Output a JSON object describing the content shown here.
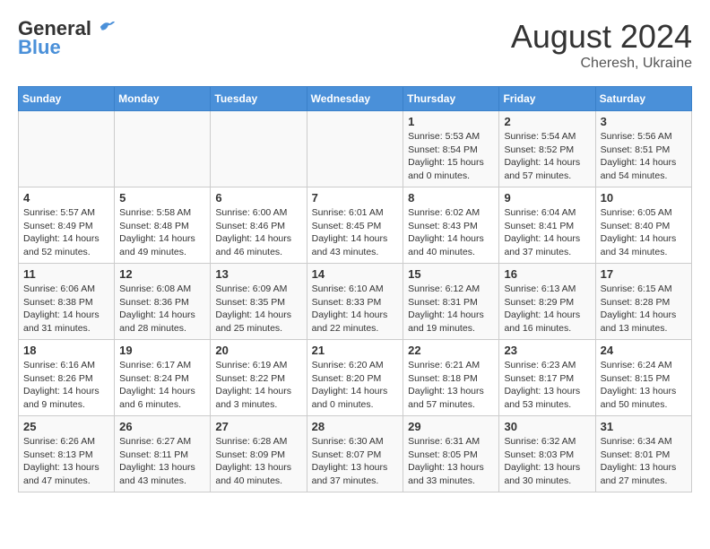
{
  "logo": {
    "line1": "General",
    "line2": "Blue"
  },
  "title": "August 2024",
  "subtitle": "Cheresh, Ukraine",
  "days_header": [
    "Sunday",
    "Monday",
    "Tuesday",
    "Wednesday",
    "Thursday",
    "Friday",
    "Saturday"
  ],
  "weeks": [
    [
      {
        "day": "",
        "info": ""
      },
      {
        "day": "",
        "info": ""
      },
      {
        "day": "",
        "info": ""
      },
      {
        "day": "",
        "info": ""
      },
      {
        "day": "1",
        "info": "Sunrise: 5:53 AM\nSunset: 8:54 PM\nDaylight: 15 hours and 0 minutes."
      },
      {
        "day": "2",
        "info": "Sunrise: 5:54 AM\nSunset: 8:52 PM\nDaylight: 14 hours and 57 minutes."
      },
      {
        "day": "3",
        "info": "Sunrise: 5:56 AM\nSunset: 8:51 PM\nDaylight: 14 hours and 54 minutes."
      }
    ],
    [
      {
        "day": "4",
        "info": "Sunrise: 5:57 AM\nSunset: 8:49 PM\nDaylight: 14 hours and 52 minutes."
      },
      {
        "day": "5",
        "info": "Sunrise: 5:58 AM\nSunset: 8:48 PM\nDaylight: 14 hours and 49 minutes."
      },
      {
        "day": "6",
        "info": "Sunrise: 6:00 AM\nSunset: 8:46 PM\nDaylight: 14 hours and 46 minutes."
      },
      {
        "day": "7",
        "info": "Sunrise: 6:01 AM\nSunset: 8:45 PM\nDaylight: 14 hours and 43 minutes."
      },
      {
        "day": "8",
        "info": "Sunrise: 6:02 AM\nSunset: 8:43 PM\nDaylight: 14 hours and 40 minutes."
      },
      {
        "day": "9",
        "info": "Sunrise: 6:04 AM\nSunset: 8:41 PM\nDaylight: 14 hours and 37 minutes."
      },
      {
        "day": "10",
        "info": "Sunrise: 6:05 AM\nSunset: 8:40 PM\nDaylight: 14 hours and 34 minutes."
      }
    ],
    [
      {
        "day": "11",
        "info": "Sunrise: 6:06 AM\nSunset: 8:38 PM\nDaylight: 14 hours and 31 minutes."
      },
      {
        "day": "12",
        "info": "Sunrise: 6:08 AM\nSunset: 8:36 PM\nDaylight: 14 hours and 28 minutes."
      },
      {
        "day": "13",
        "info": "Sunrise: 6:09 AM\nSunset: 8:35 PM\nDaylight: 14 hours and 25 minutes."
      },
      {
        "day": "14",
        "info": "Sunrise: 6:10 AM\nSunset: 8:33 PM\nDaylight: 14 hours and 22 minutes."
      },
      {
        "day": "15",
        "info": "Sunrise: 6:12 AM\nSunset: 8:31 PM\nDaylight: 14 hours and 19 minutes."
      },
      {
        "day": "16",
        "info": "Sunrise: 6:13 AM\nSunset: 8:29 PM\nDaylight: 14 hours and 16 minutes."
      },
      {
        "day": "17",
        "info": "Sunrise: 6:15 AM\nSunset: 8:28 PM\nDaylight: 14 hours and 13 minutes."
      }
    ],
    [
      {
        "day": "18",
        "info": "Sunrise: 6:16 AM\nSunset: 8:26 PM\nDaylight: 14 hours and 9 minutes."
      },
      {
        "day": "19",
        "info": "Sunrise: 6:17 AM\nSunset: 8:24 PM\nDaylight: 14 hours and 6 minutes."
      },
      {
        "day": "20",
        "info": "Sunrise: 6:19 AM\nSunset: 8:22 PM\nDaylight: 14 hours and 3 minutes."
      },
      {
        "day": "21",
        "info": "Sunrise: 6:20 AM\nSunset: 8:20 PM\nDaylight: 14 hours and 0 minutes."
      },
      {
        "day": "22",
        "info": "Sunrise: 6:21 AM\nSunset: 8:18 PM\nDaylight: 13 hours and 57 minutes."
      },
      {
        "day": "23",
        "info": "Sunrise: 6:23 AM\nSunset: 8:17 PM\nDaylight: 13 hours and 53 minutes."
      },
      {
        "day": "24",
        "info": "Sunrise: 6:24 AM\nSunset: 8:15 PM\nDaylight: 13 hours and 50 minutes."
      }
    ],
    [
      {
        "day": "25",
        "info": "Sunrise: 6:26 AM\nSunset: 8:13 PM\nDaylight: 13 hours and 47 minutes."
      },
      {
        "day": "26",
        "info": "Sunrise: 6:27 AM\nSunset: 8:11 PM\nDaylight: 13 hours and 43 minutes."
      },
      {
        "day": "27",
        "info": "Sunrise: 6:28 AM\nSunset: 8:09 PM\nDaylight: 13 hours and 40 minutes."
      },
      {
        "day": "28",
        "info": "Sunrise: 6:30 AM\nSunset: 8:07 PM\nDaylight: 13 hours and 37 minutes."
      },
      {
        "day": "29",
        "info": "Sunrise: 6:31 AM\nSunset: 8:05 PM\nDaylight: 13 hours and 33 minutes."
      },
      {
        "day": "30",
        "info": "Sunrise: 6:32 AM\nSunset: 8:03 PM\nDaylight: 13 hours and 30 minutes."
      },
      {
        "day": "31",
        "info": "Sunrise: 6:34 AM\nSunset: 8:01 PM\nDaylight: 13 hours and 27 minutes."
      }
    ]
  ]
}
